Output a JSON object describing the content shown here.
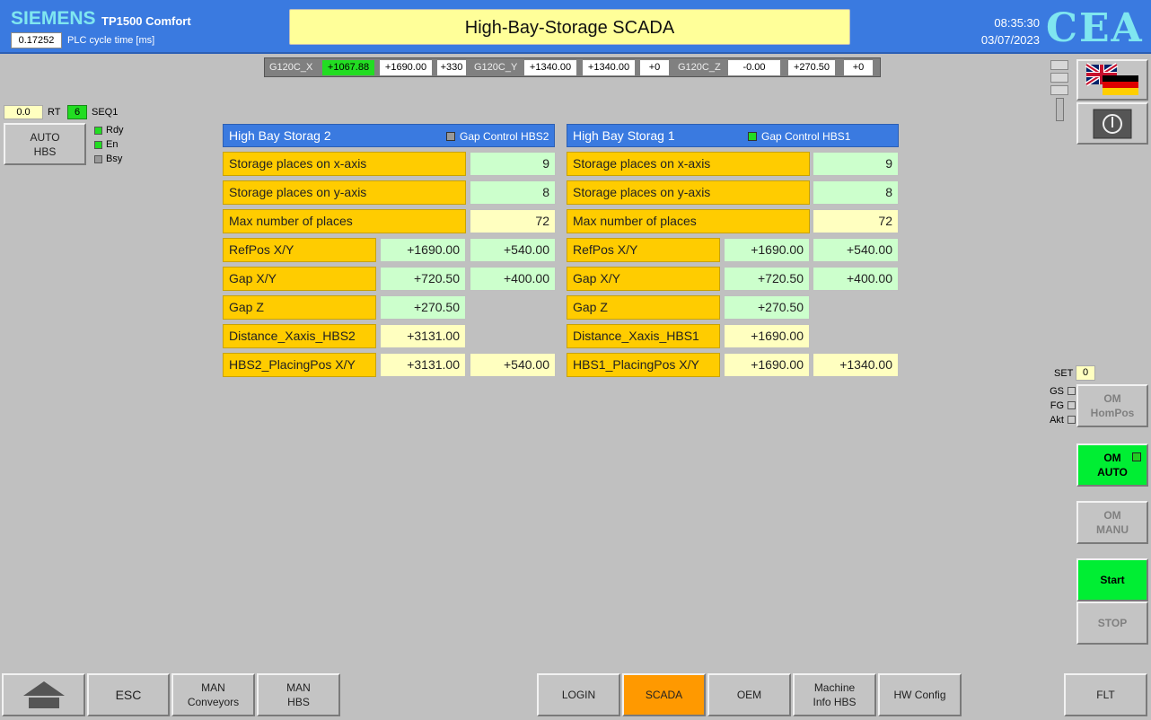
{
  "header": {
    "brand": "SIEMENS",
    "model": "TP1500 Comfort",
    "cycle_value": "0.17252",
    "cycle_label": "PLC cycle time [ms]",
    "title": "High-Bay-Storage SCADA",
    "time": "08:35:30",
    "date": "03/07/2023",
    "logo": "CEA"
  },
  "drives": [
    {
      "label": "G120C_X",
      "actual": "+1067.88",
      "target": "+1690.00",
      "step": "+330"
    },
    {
      "label": "G120C_Y",
      "actual": "+1340.00",
      "target": "+1340.00",
      "step": "+0"
    },
    {
      "label": "G120C_Z",
      "actual": "-0.00",
      "target": "+270.50",
      "step": "+0"
    }
  ],
  "left": {
    "rt_value": "0.0",
    "rt_label": "RT",
    "seq_value": "6",
    "seq_label": "SEQ1",
    "auto_hbs": [
      "AUTO",
      "HBS"
    ],
    "leds": [
      {
        "label": "Rdy",
        "state": "on"
      },
      {
        "label": "En",
        "state": "on"
      },
      {
        "label": "Bsy",
        "state": "off"
      }
    ]
  },
  "hbs2": {
    "title": "High Bay Storag 2",
    "gap_control": "Gap Control HBS2",
    "gap_led_color": "#999999",
    "rows": {
      "x_label": "Storage places on x-axis",
      "x_value": "9",
      "y_label": "Storage places on y-axis",
      "y_value": "8",
      "max_label": "Max number of places",
      "max_value": "72",
      "ref_label": "RefPos X/Y",
      "ref_x": "+1690.00",
      "ref_y": "+540.00",
      "gap_label": "Gap X/Y",
      "gap_x": "+720.50",
      "gap_y": "+400.00",
      "gapz_label": "Gap Z",
      "gapz": "+270.50",
      "dist_label": "Distance_Xaxis_HBS2",
      "dist": "+3131.00",
      "place_label": "HBS2_PlacingPos X/Y",
      "place_x": "+3131.00",
      "place_y": "+540.00"
    }
  },
  "hbs1": {
    "title": "High Bay Storag 1",
    "gap_control": "Gap Control HBS1",
    "gap_led_color": "#22dd22",
    "rows": {
      "x_label": "Storage places on x-axis",
      "x_value": "9",
      "y_label": "Storage places on y-axis",
      "y_value": "8",
      "max_label": "Max number of places",
      "max_value": "72",
      "ref_label": "RefPos X/Y",
      "ref_x": "+1690.00",
      "ref_y": "+540.00",
      "gap_label": "Gap X/Y",
      "gap_x": "+720.50",
      "gap_y": "+400.00",
      "gapz_label": "Gap Z",
      "gapz": "+270.50",
      "dist_label": "Distance_Xaxis_HBS1",
      "dist": "+1690.00",
      "place_label": "HBS1_PlacingPos X/Y",
      "place_x": "+1690.00",
      "place_y": "+1340.00"
    }
  },
  "right": {
    "set_label": "SET",
    "set_value": "0",
    "status_leds": [
      "GS",
      "FG",
      "Akt"
    ],
    "om_hompos": [
      "OM",
      "HomPos"
    ],
    "om_auto": [
      "OM",
      "AUTO"
    ],
    "om_manu": [
      "OM",
      "MANU"
    ],
    "start": "Start",
    "stop": "STOP"
  },
  "nav": {
    "esc": "ESC",
    "man_conveyors": [
      "MAN",
      "Conveyors"
    ],
    "man_hbs": [
      "MAN",
      "HBS"
    ],
    "login": "LOGIN",
    "scada": "SCADA",
    "oem": "OEM",
    "machine_info": [
      "Machine",
      "Info HBS"
    ],
    "hw_config": "HW Config",
    "flt": "FLT"
  },
  "colors": {
    "header_blue": "#3a7ae0",
    "label_orange": "#ffcc00",
    "value_mint": "#ccffcc",
    "value_cream": "#ffffc0",
    "active_green": "#00ee33",
    "active_tab": "#ff9900"
  },
  "icons": [
    "home-icon",
    "uk-flag-icon",
    "german-flag-icon",
    "power-icon"
  ]
}
